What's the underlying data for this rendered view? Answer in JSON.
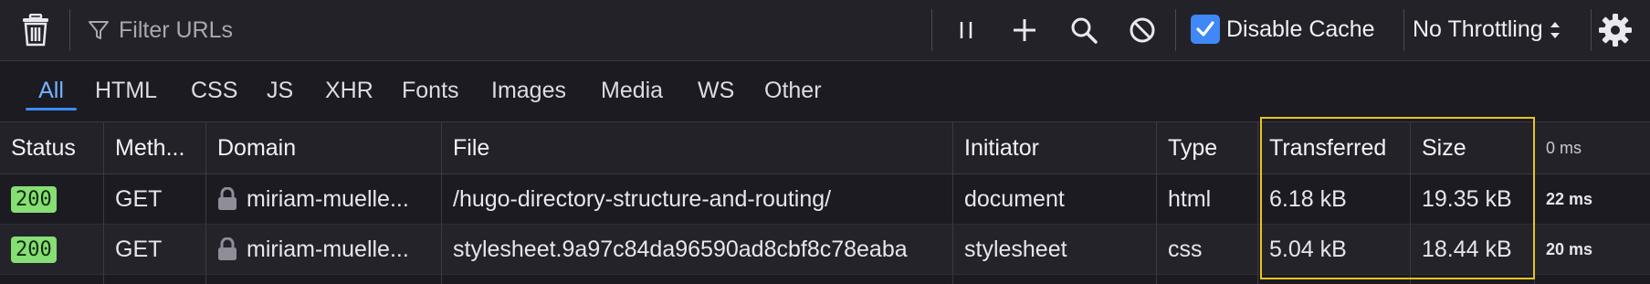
{
  "toolbar": {
    "filter_placeholder": "Filter URLs",
    "disable_cache_label": "Disable Cache",
    "disable_cache_checked": true,
    "throttling_value": "No Throttling"
  },
  "tabs": [
    "All",
    "HTML",
    "CSS",
    "JS",
    "XHR",
    "Fonts",
    "Images",
    "Media",
    "WS",
    "Other"
  ],
  "active_tab": "All",
  "columns": {
    "status": "Status",
    "method": "Meth...",
    "domain": "Domain",
    "file": "File",
    "initiator": "Initiator",
    "type": "Type",
    "transferred": "Transferred",
    "size": "Size",
    "timeline": "0 ms"
  },
  "rows": [
    {
      "status": "200",
      "method": "GET",
      "domain": "miriam-muelle...",
      "file": "/hugo-directory-structure-and-routing/",
      "initiator": "document",
      "type": "html",
      "transferred": "6.18 kB",
      "size": "19.35 kB",
      "time": "22 ms"
    },
    {
      "status": "200",
      "method": "GET",
      "domain": "miriam-muelle...",
      "file": "stylesheet.9a97c84da96590ad8cbf8c78eaba",
      "initiator": "stylesheet",
      "type": "css",
      "transferred": "5.04 kB",
      "size": "18.44 kB",
      "time": "20 ms"
    }
  ],
  "colors": {
    "accent": "#3a8df5",
    "status_ok": "#86de74",
    "highlight": "#e7c51a"
  }
}
